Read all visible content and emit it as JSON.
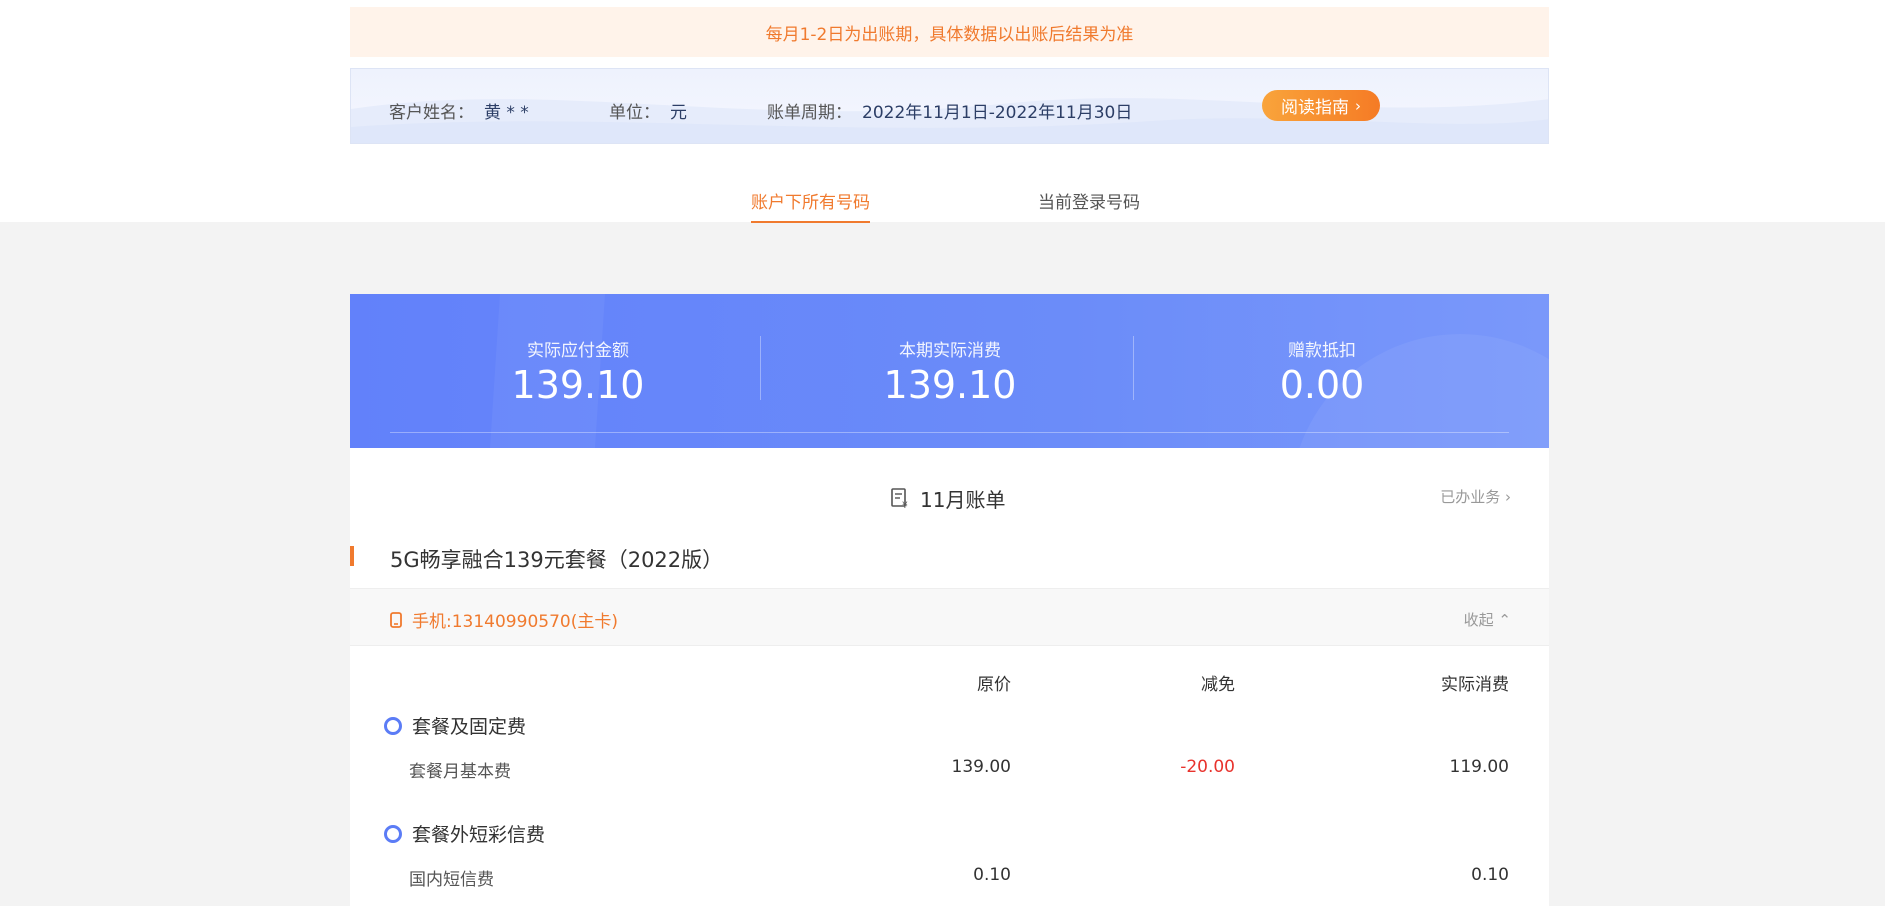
{
  "notice": "每月1-2日为出账期，具体数据以出账后结果为准",
  "info": {
    "customer_label": "客户姓名：",
    "customer_value": "黄 * *",
    "unit_label": "单位：",
    "unit_value": "元",
    "period_label": "账单周期：",
    "period_value": "2022年11月1日-2022年11月30日",
    "guide_button": "阅读指南"
  },
  "tabs": [
    {
      "label": "账户下所有号码",
      "active": true
    },
    {
      "label": "当前登录号码",
      "active": false
    }
  ],
  "summary": [
    {
      "label": "实际应付金额",
      "value": "139.10"
    },
    {
      "label": "本期实际消费",
      "value": "139.10"
    },
    {
      "label": "赠款抵扣",
      "value": "0.00"
    }
  ],
  "bill": {
    "title": "11月账单",
    "handled_link": "已办业务",
    "plan_name": "5G畅享融合139元套餐（2022版）",
    "phone": "手机:13140990570(主卡)",
    "collapse": "收起",
    "columns": [
      "原价",
      "减免",
      "实际消费"
    ],
    "sections": [
      {
        "name": "套餐及固定费",
        "rows": [
          {
            "label": "套餐月基本费",
            "original": "139.00",
            "discount": "-20.00",
            "actual": "119.00"
          }
        ]
      },
      {
        "name": "套餐外短彩信费",
        "rows": [
          {
            "label": "国内短信费",
            "original": "0.10",
            "discount": "",
            "actual": "0.10"
          }
        ]
      }
    ]
  },
  "colors": {
    "accent_orange": "#f07a2e",
    "summary_blue": "#6281fa",
    "discount_red": "#e8332d"
  }
}
